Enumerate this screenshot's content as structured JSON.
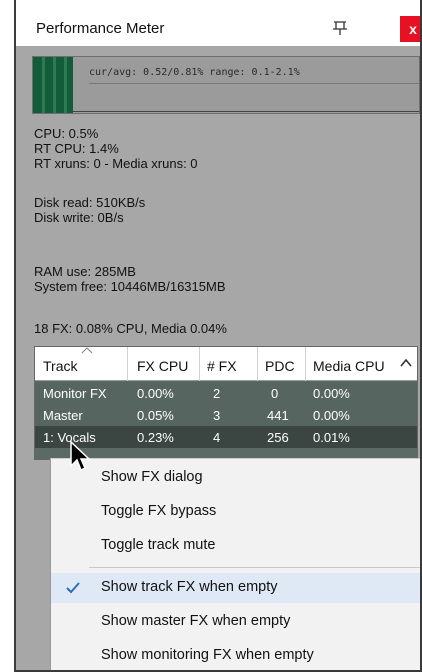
{
  "window": {
    "title": "Performance Meter",
    "close_label": "x"
  },
  "meter": {
    "text": "cur/avg: 0.52/0.81%  range: 0.1-2.1%"
  },
  "stats": {
    "cpu": "CPU: 0.5%",
    "rt_cpu": "RT CPU: 1.4%",
    "xruns": "RT xruns: 0 - Media xruns: 0",
    "disk_read": "Disk read: 510KB/s",
    "disk_write": "Disk write: 0B/s",
    "ram_use": "RAM use: 285MB",
    "system_free": "System free: 10446MB/16315MB",
    "fx_summary": "18 FX: 0.08% CPU, Media 0.04%"
  },
  "table": {
    "columns": [
      "Track",
      "FX CPU",
      "# FX",
      "PDC",
      "Media CPU"
    ],
    "rows": [
      [
        "Monitor FX",
        "0.00%",
        "2",
        "0",
        "0.00%"
      ],
      [
        "Master",
        "0.05%",
        "3",
        "441",
        "0.00%"
      ],
      [
        "1: Vocals",
        "0.23%",
        "4",
        "256",
        "0.01%"
      ]
    ]
  },
  "menu": {
    "items": [
      "Show FX dialog",
      "Toggle FX bypass",
      "Toggle track mute",
      "Show track FX when empty",
      "Show master FX when empty",
      "Show monitoring FX when empty"
    ],
    "checked": [
      false,
      false,
      false,
      true,
      false,
      false
    ]
  },
  "icons": {
    "pin": "pin-icon",
    "close": "close-icon",
    "sort": "sort-arrow-icon",
    "scroll": "scroll-up-icon",
    "check": "check-icon",
    "cursor": "mouse-cursor-icon"
  },
  "colors": {
    "close_button": "#e81123",
    "meter_fill": "#135c3a",
    "row_selected": "#2f3b38",
    "check": "#2b6fb4"
  }
}
